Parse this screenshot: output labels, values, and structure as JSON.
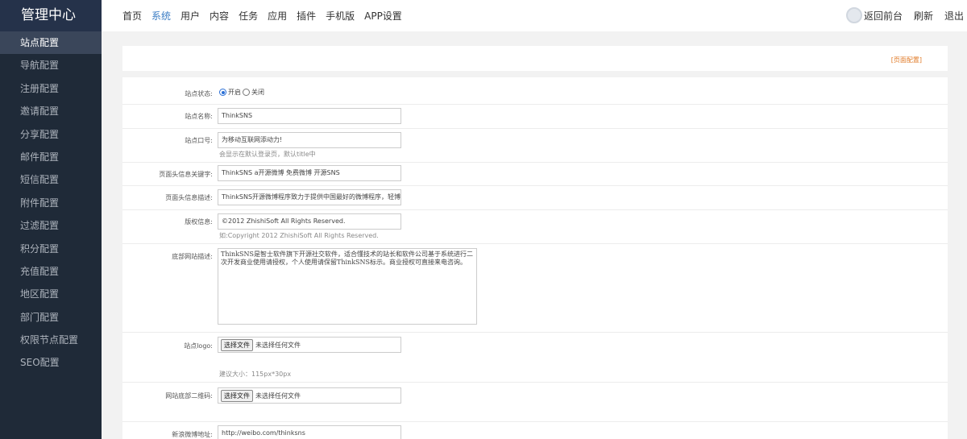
{
  "sidebar": {
    "title": "管理中心",
    "items": [
      {
        "label": "站点配置",
        "active": true
      },
      {
        "label": "导航配置"
      },
      {
        "label": "注册配置"
      },
      {
        "label": "邀请配置"
      },
      {
        "label": "分享配置"
      },
      {
        "label": "邮件配置"
      },
      {
        "label": "短信配置"
      },
      {
        "label": "附件配置"
      },
      {
        "label": "过滤配置"
      },
      {
        "label": "积分配置"
      },
      {
        "label": "充值配置"
      },
      {
        "label": "地区配置"
      },
      {
        "label": "部门配置"
      },
      {
        "label": "权限节点配置"
      },
      {
        "label": "SEO配置"
      }
    ]
  },
  "topnav": {
    "items": [
      {
        "label": "首页"
      },
      {
        "label": "系统",
        "active": true
      },
      {
        "label": "用户"
      },
      {
        "label": "内容"
      },
      {
        "label": "任务"
      },
      {
        "label": "应用"
      },
      {
        "label": "插件"
      },
      {
        "label": "手机版"
      },
      {
        "label": "APP设置"
      }
    ],
    "links": [
      "返回前台",
      "刷新",
      "退出"
    ]
  },
  "page": {
    "config_link": "[页面配置]"
  },
  "form": {
    "status": {
      "label": "站点状态:",
      "options": [
        "开启",
        "关闭"
      ],
      "selected": "开启"
    },
    "site_name": {
      "label": "站点名称:",
      "value": "ThinkSNS"
    },
    "slogan": {
      "label": "站点口号:",
      "value": "为移动互联网添动力!",
      "hint": "会显示在默认登录页，默认title中"
    },
    "keywords": {
      "label": "页面头信息关键字:",
      "value": "ThinkSNS a开源微博 免费微博 开源SNS"
    },
    "description": {
      "label": "页面头信息描述:",
      "value": "ThinkSNS开源微博程序致力于提供中国最好的微博程序，轻博客系"
    },
    "copyright": {
      "label": "版权信息:",
      "value": "©2012 ZhishiSoft All Rights Reserved.",
      "hint": "如:Copyright 2012 ZhishiSoft All Rights Reserved."
    },
    "footer_desc": {
      "label": "底部网站描述:",
      "value": "ThinkSNS是智士软件旗下开源社交软件，适合懂技术的站长和软件公司基于系统进行二次开发商业使用请授权，个人使用请保留ThinkSNS标示。商业授权可直接来电咨询。"
    },
    "logo": {
      "label": "站点logo:",
      "button": "选择文件",
      "status": "未选择任何文件",
      "hint": "建议大小：115px*30px"
    },
    "qrcode": {
      "label": "网站底部二维码:",
      "button": "选择文件",
      "status": "未选择任何文件"
    },
    "weibo": {
      "label": "新浪微博地址:",
      "value": "http://weibo.com/thinksns"
    }
  }
}
